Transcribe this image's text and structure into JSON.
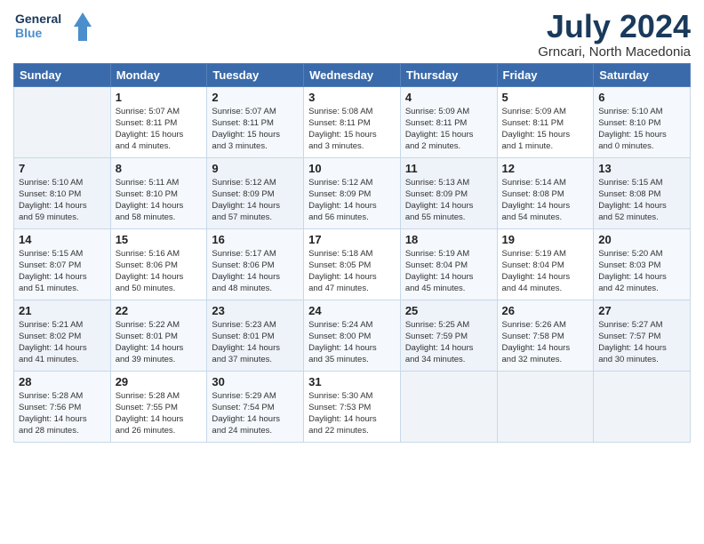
{
  "header": {
    "logo_line1": "General",
    "logo_line2": "Blue",
    "month_year": "July 2024",
    "location": "Grncari, North Macedonia"
  },
  "weekdays": [
    "Sunday",
    "Monday",
    "Tuesday",
    "Wednesday",
    "Thursday",
    "Friday",
    "Saturday"
  ],
  "weeks": [
    [
      {
        "day": "",
        "info": ""
      },
      {
        "day": "1",
        "info": "Sunrise: 5:07 AM\nSunset: 8:11 PM\nDaylight: 15 hours\nand 4 minutes."
      },
      {
        "day": "2",
        "info": "Sunrise: 5:07 AM\nSunset: 8:11 PM\nDaylight: 15 hours\nand 3 minutes."
      },
      {
        "day": "3",
        "info": "Sunrise: 5:08 AM\nSunset: 8:11 PM\nDaylight: 15 hours\nand 3 minutes."
      },
      {
        "day": "4",
        "info": "Sunrise: 5:09 AM\nSunset: 8:11 PM\nDaylight: 15 hours\nand 2 minutes."
      },
      {
        "day": "5",
        "info": "Sunrise: 5:09 AM\nSunset: 8:11 PM\nDaylight: 15 hours\nand 1 minute."
      },
      {
        "day": "6",
        "info": "Sunrise: 5:10 AM\nSunset: 8:10 PM\nDaylight: 15 hours\nand 0 minutes."
      }
    ],
    [
      {
        "day": "7",
        "info": "Sunrise: 5:10 AM\nSunset: 8:10 PM\nDaylight: 14 hours\nand 59 minutes."
      },
      {
        "day": "8",
        "info": "Sunrise: 5:11 AM\nSunset: 8:10 PM\nDaylight: 14 hours\nand 58 minutes."
      },
      {
        "day": "9",
        "info": "Sunrise: 5:12 AM\nSunset: 8:09 PM\nDaylight: 14 hours\nand 57 minutes."
      },
      {
        "day": "10",
        "info": "Sunrise: 5:12 AM\nSunset: 8:09 PM\nDaylight: 14 hours\nand 56 minutes."
      },
      {
        "day": "11",
        "info": "Sunrise: 5:13 AM\nSunset: 8:09 PM\nDaylight: 14 hours\nand 55 minutes."
      },
      {
        "day": "12",
        "info": "Sunrise: 5:14 AM\nSunset: 8:08 PM\nDaylight: 14 hours\nand 54 minutes."
      },
      {
        "day": "13",
        "info": "Sunrise: 5:15 AM\nSunset: 8:08 PM\nDaylight: 14 hours\nand 52 minutes."
      }
    ],
    [
      {
        "day": "14",
        "info": "Sunrise: 5:15 AM\nSunset: 8:07 PM\nDaylight: 14 hours\nand 51 minutes."
      },
      {
        "day": "15",
        "info": "Sunrise: 5:16 AM\nSunset: 8:06 PM\nDaylight: 14 hours\nand 50 minutes."
      },
      {
        "day": "16",
        "info": "Sunrise: 5:17 AM\nSunset: 8:06 PM\nDaylight: 14 hours\nand 48 minutes."
      },
      {
        "day": "17",
        "info": "Sunrise: 5:18 AM\nSunset: 8:05 PM\nDaylight: 14 hours\nand 47 minutes."
      },
      {
        "day": "18",
        "info": "Sunrise: 5:19 AM\nSunset: 8:04 PM\nDaylight: 14 hours\nand 45 minutes."
      },
      {
        "day": "19",
        "info": "Sunrise: 5:19 AM\nSunset: 8:04 PM\nDaylight: 14 hours\nand 44 minutes."
      },
      {
        "day": "20",
        "info": "Sunrise: 5:20 AM\nSunset: 8:03 PM\nDaylight: 14 hours\nand 42 minutes."
      }
    ],
    [
      {
        "day": "21",
        "info": "Sunrise: 5:21 AM\nSunset: 8:02 PM\nDaylight: 14 hours\nand 41 minutes."
      },
      {
        "day": "22",
        "info": "Sunrise: 5:22 AM\nSunset: 8:01 PM\nDaylight: 14 hours\nand 39 minutes."
      },
      {
        "day": "23",
        "info": "Sunrise: 5:23 AM\nSunset: 8:01 PM\nDaylight: 14 hours\nand 37 minutes."
      },
      {
        "day": "24",
        "info": "Sunrise: 5:24 AM\nSunset: 8:00 PM\nDaylight: 14 hours\nand 35 minutes."
      },
      {
        "day": "25",
        "info": "Sunrise: 5:25 AM\nSunset: 7:59 PM\nDaylight: 14 hours\nand 34 minutes."
      },
      {
        "day": "26",
        "info": "Sunrise: 5:26 AM\nSunset: 7:58 PM\nDaylight: 14 hours\nand 32 minutes."
      },
      {
        "day": "27",
        "info": "Sunrise: 5:27 AM\nSunset: 7:57 PM\nDaylight: 14 hours\nand 30 minutes."
      }
    ],
    [
      {
        "day": "28",
        "info": "Sunrise: 5:28 AM\nSunset: 7:56 PM\nDaylight: 14 hours\nand 28 minutes."
      },
      {
        "day": "29",
        "info": "Sunrise: 5:28 AM\nSunset: 7:55 PM\nDaylight: 14 hours\nand 26 minutes."
      },
      {
        "day": "30",
        "info": "Sunrise: 5:29 AM\nSunset: 7:54 PM\nDaylight: 14 hours\nand 24 minutes."
      },
      {
        "day": "31",
        "info": "Sunrise: 5:30 AM\nSunset: 7:53 PM\nDaylight: 14 hours\nand 22 minutes."
      },
      {
        "day": "",
        "info": ""
      },
      {
        "day": "",
        "info": ""
      },
      {
        "day": "",
        "info": ""
      }
    ]
  ]
}
